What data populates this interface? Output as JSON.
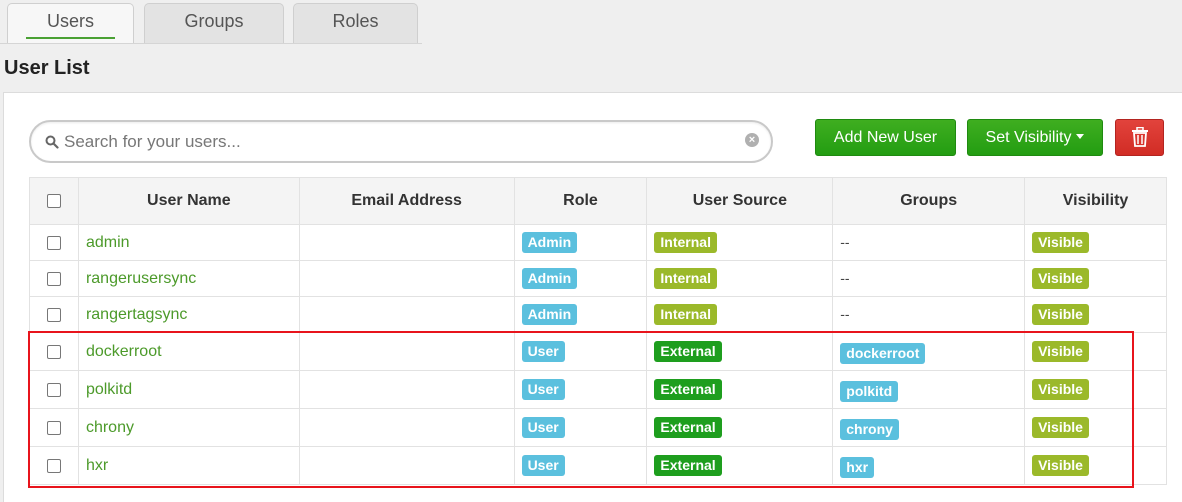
{
  "tabs": [
    {
      "label": "Users",
      "active": true
    },
    {
      "label": "Groups",
      "active": false
    },
    {
      "label": "Roles",
      "active": false
    }
  ],
  "page_title": "User List",
  "search": {
    "placeholder": "Search for your users...",
    "value": ""
  },
  "toolbar": {
    "add_label": "Add New User",
    "visibility_label": "Set Visibility"
  },
  "icons": {
    "search": "search-icon",
    "clear": "clear-icon",
    "delete": "trash-icon",
    "dropdown": "caret-down-icon"
  },
  "colors": {
    "accent_green": "#239d12",
    "danger": "#d12c25",
    "link": "#4c9a2a",
    "highlight": "#e8141c"
  },
  "table": {
    "headers": [
      "User Name",
      "Email Address",
      "Role",
      "User Source",
      "Groups",
      "Visibility"
    ],
    "rows": [
      {
        "name": "admin",
        "email": "",
        "role": "Admin",
        "source": "Internal",
        "groups": "--",
        "visibility": "Visible"
      },
      {
        "name": "rangerusersync",
        "email": "",
        "role": "Admin",
        "source": "Internal",
        "groups": "--",
        "visibility": "Visible"
      },
      {
        "name": "rangertagsync",
        "email": "",
        "role": "Admin",
        "source": "Internal",
        "groups": "--",
        "visibility": "Visible"
      },
      {
        "name": "dockerroot",
        "email": "",
        "role": "User",
        "source": "External",
        "groups": "dockerroot",
        "visibility": "Visible"
      },
      {
        "name": "polkitd",
        "email": "",
        "role": "User",
        "source": "External",
        "groups": "polkitd",
        "visibility": "Visible"
      },
      {
        "name": "chrony",
        "email": "",
        "role": "User",
        "source": "External",
        "groups": "chrony",
        "visibility": "Visible"
      },
      {
        "name": "hxr",
        "email": "",
        "role": "User",
        "source": "External",
        "groups": "hxr",
        "visibility": "Visible"
      }
    ]
  }
}
